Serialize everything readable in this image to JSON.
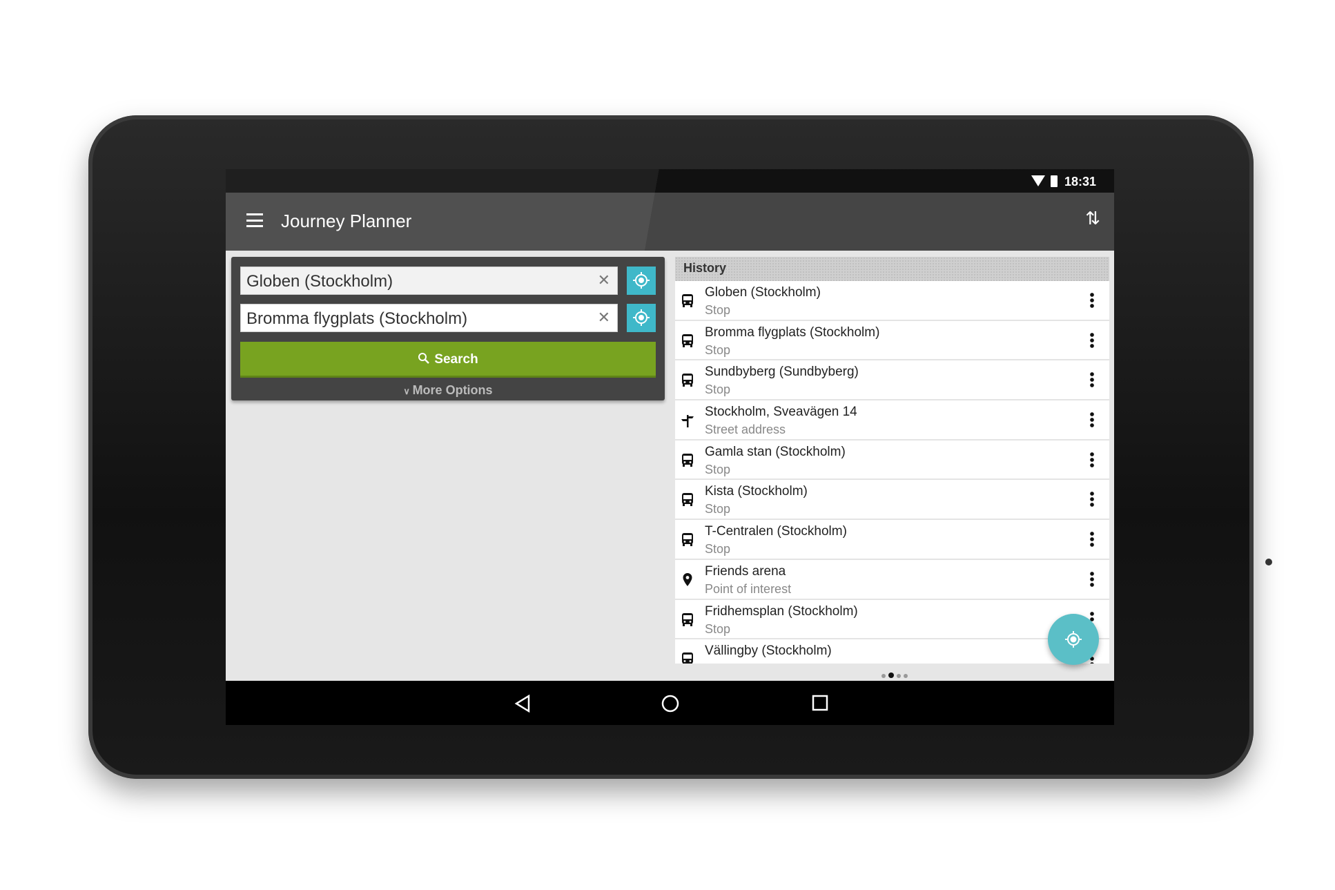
{
  "status": {
    "time": "18:31"
  },
  "appbar": {
    "title": "Journey Planner"
  },
  "form": {
    "from": "Globen (Stockholm)",
    "to": "Bromma flygplats (Stockholm)",
    "search_label": "Search",
    "more_options": "More Options"
  },
  "history": {
    "header": "History",
    "items": [
      {
        "name": "Globen (Stockholm)",
        "type": "Stop",
        "icon": "bus-icon"
      },
      {
        "name": "Bromma flygplats (Stockholm)",
        "type": "Stop",
        "icon": "bus-icon"
      },
      {
        "name": "Sundbyberg (Sundbyberg)",
        "type": "Stop",
        "icon": "bus-icon"
      },
      {
        "name": "Stockholm, Sveavägen 14",
        "type": "Street address",
        "icon": "signpost-icon"
      },
      {
        "name": "Gamla stan (Stockholm)",
        "type": "Stop",
        "icon": "bus-icon"
      },
      {
        "name": "Kista (Stockholm)",
        "type": "Stop",
        "icon": "bus-icon"
      },
      {
        "name": "T-Centralen (Stockholm)",
        "type": "Stop",
        "icon": "bus-icon"
      },
      {
        "name": "Friends arena",
        "type": "Point of interest",
        "icon": "pin-icon"
      },
      {
        "name": "Fridhemsplan (Stockholm)",
        "type": "Stop",
        "icon": "bus-icon"
      },
      {
        "name": "Vällingby (Stockholm)",
        "type": "",
        "icon": "bus-icon"
      }
    ]
  },
  "pager": {
    "pages": 4,
    "current": 2
  },
  "colors": {
    "accent": "#3fb8c9",
    "search": "#78a320",
    "appbar": "#454545",
    "fab": "#5bbfc7"
  }
}
